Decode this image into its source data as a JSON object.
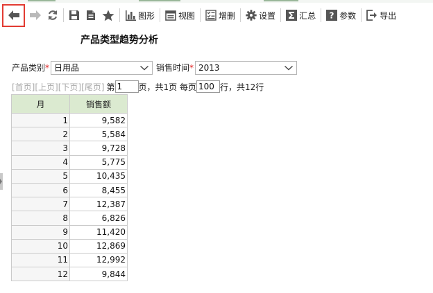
{
  "toolbar": {
    "items": [
      {
        "name": "back-button",
        "icon": "arrow-left-icon",
        "label": ""
      },
      {
        "name": "forward-button",
        "icon": "arrow-right-icon",
        "label": ""
      },
      {
        "name": "refresh-button",
        "icon": "refresh-icon",
        "label": ""
      },
      {
        "name": "save-button",
        "icon": "save-icon",
        "label": ""
      },
      {
        "name": "saveas-button",
        "icon": "document-icon",
        "label": ""
      },
      {
        "name": "favorite-button",
        "icon": "star-icon",
        "label": ""
      },
      {
        "name": "chart-button",
        "icon": "bar-chart-icon",
        "label": "图形"
      },
      {
        "name": "view-button",
        "icon": "window-icon",
        "label": "视图"
      },
      {
        "name": "edit-button",
        "icon": "checklist-icon",
        "label": "增删"
      },
      {
        "name": "settings-button",
        "icon": "gear-icon",
        "label": "设置"
      },
      {
        "name": "summary-button",
        "icon": "sigma-icon",
        "label": "汇总"
      },
      {
        "name": "params-button",
        "icon": "help-icon",
        "label": "参数"
      },
      {
        "name": "export-button",
        "icon": "export-icon",
        "label": "导出"
      }
    ]
  },
  "report": {
    "title": "产品类型趋势分析"
  },
  "filters": {
    "category_label": "产品类别",
    "category_value": "日用品",
    "time_label": "销售时间",
    "time_value": "2013",
    "required_mark": "*"
  },
  "pager": {
    "first": "[首页]",
    "prev": "[上页]",
    "next": "[下页]",
    "last": "[尾页]",
    "page_prefix": "第",
    "current_page": "1",
    "page_suffix": "页，共1页 每页",
    "page_size": "100",
    "total_text": "行，共12行"
  },
  "table": {
    "headers": [
      "月",
      "销售额"
    ],
    "rows": [
      [
        "1",
        "9,582"
      ],
      [
        "2",
        "5,584"
      ],
      [
        "3",
        "9,728"
      ],
      [
        "4",
        "5,775"
      ],
      [
        "5",
        "10,435"
      ],
      [
        "6",
        "8,455"
      ],
      [
        "7",
        "12,387"
      ],
      [
        "8",
        "6,826"
      ],
      [
        "9",
        "11,420"
      ],
      [
        "10",
        "12,869"
      ],
      [
        "11",
        "12,992"
      ],
      [
        "12",
        "9,844"
      ]
    ]
  },
  "colors": {
    "header_bg": "#dbead0",
    "accent_red": "#e23b32",
    "required_red": "#e02020",
    "link_gray": "#a9a9a9"
  }
}
